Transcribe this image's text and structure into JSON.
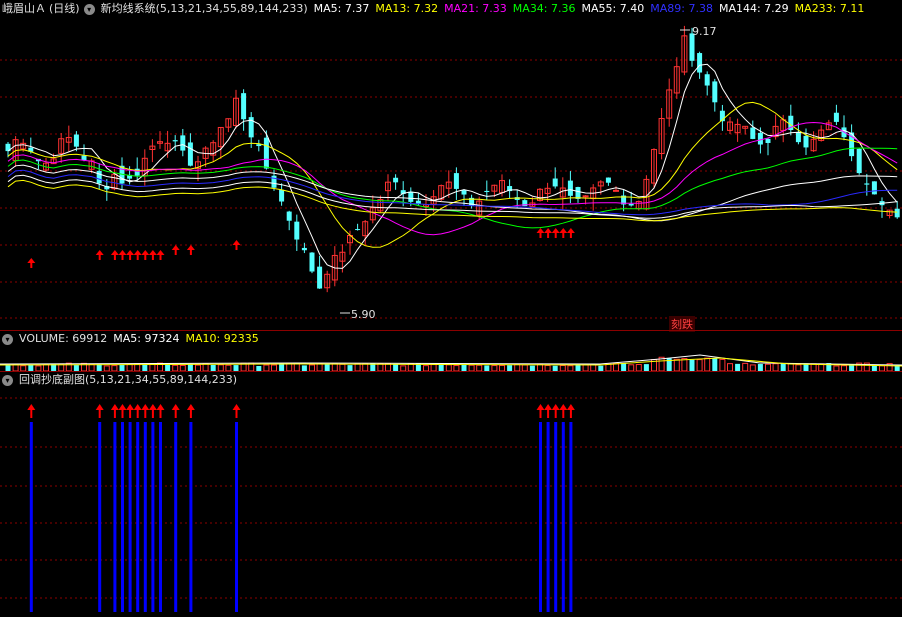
{
  "main": {
    "stock_name": "峨眉山Ａ",
    "period": "(日线)",
    "indicator": "新均线系统(5,13,21,34,55,89,144,233)",
    "ma": [
      {
        "label": "MA5: 7.37",
        "color": "#ffffff"
      },
      {
        "label": "MA13: 7.32",
        "color": "#ffff00"
      },
      {
        "label": "MA21: 7.33",
        "color": "#ff00ff"
      },
      {
        "label": "MA34: 7.36",
        "color": "#00ff00"
      },
      {
        "label": "MA55: 7.40",
        "color": "#ffffff"
      },
      {
        "label": "MA89: 7.38",
        "color": "#0000ff"
      },
      {
        "label": "MA144: 7.29",
        "color": "#ffffff"
      },
      {
        "label": "MA233: 7.11",
        "color": "#ffff00"
      }
    ],
    "high_label": "9.17",
    "low_label": "5.90",
    "tag_text": "刻跌"
  },
  "volume": {
    "label": "VOLUME: 69912",
    "ma5": "MA5: 97324",
    "ma10": "MA10: 92335"
  },
  "sub": {
    "title": "回调抄底副图(5,13,21,34,55,89,144,233)"
  },
  "colors": {
    "up": "#ff3232",
    "down": "#54ffff",
    "grid": "#8b0000",
    "signal_bar": "#0000ff",
    "arrow": "#ff0000"
  },
  "signal_indices": [
    3,
    12,
    14,
    15,
    16,
    17,
    18,
    19,
    20,
    22,
    24,
    30,
    70,
    71,
    72,
    73,
    74
  ]
}
